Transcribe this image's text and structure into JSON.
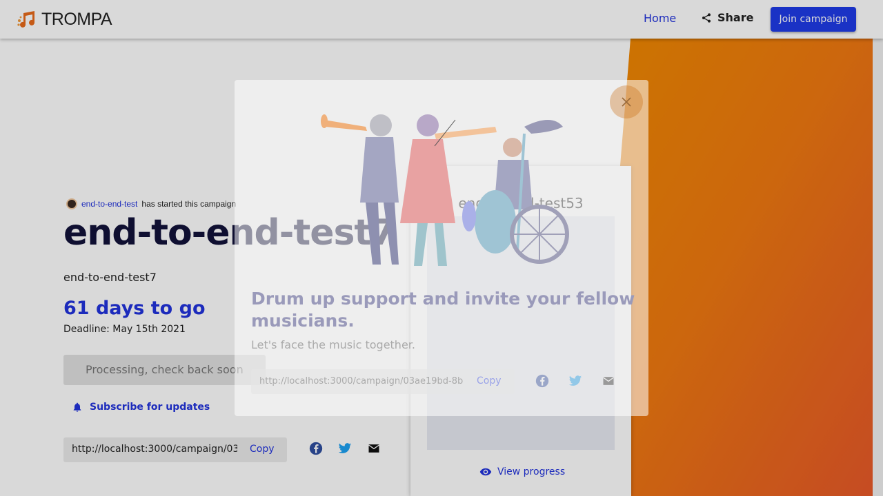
{
  "header": {
    "brand": "TROMPA",
    "nav_home": "Home",
    "nav_share": "Share",
    "join_button": "Join campaign"
  },
  "campaign": {
    "starter_user": "end-to-end-test",
    "starter_suffix": "has started this campaign",
    "title": "end-to-end-test7",
    "description": "end-to-end-test7",
    "countdown": "61 days to go",
    "deadline": "Deadline: May 15th 2021",
    "processing_label": "Processing, check back soon",
    "subscribe_label": "Subscribe for updates",
    "share_url": "http://localhost:3000/campaign/03ae19bd-8b",
    "copy_label": "Copy"
  },
  "card": {
    "title": "end-to-end-test53",
    "view_progress": "View progress"
  },
  "modal": {
    "heading": "Drum up support and invite your fellow musicians.",
    "subheading": "Let's face the music together.",
    "share_url": "http://localhost:3000/campaign/03ae19bd-8b",
    "copy_label": "Copy"
  },
  "icons": [
    "trompa-logo-icon",
    "share-icon",
    "bell-icon",
    "facebook-icon",
    "twitter-icon",
    "email-icon",
    "eye-icon",
    "close-icon"
  ],
  "colors": {
    "accent_blue": "#1f3be8",
    "title_navy": "#12123a",
    "orange": "#f08a00"
  }
}
